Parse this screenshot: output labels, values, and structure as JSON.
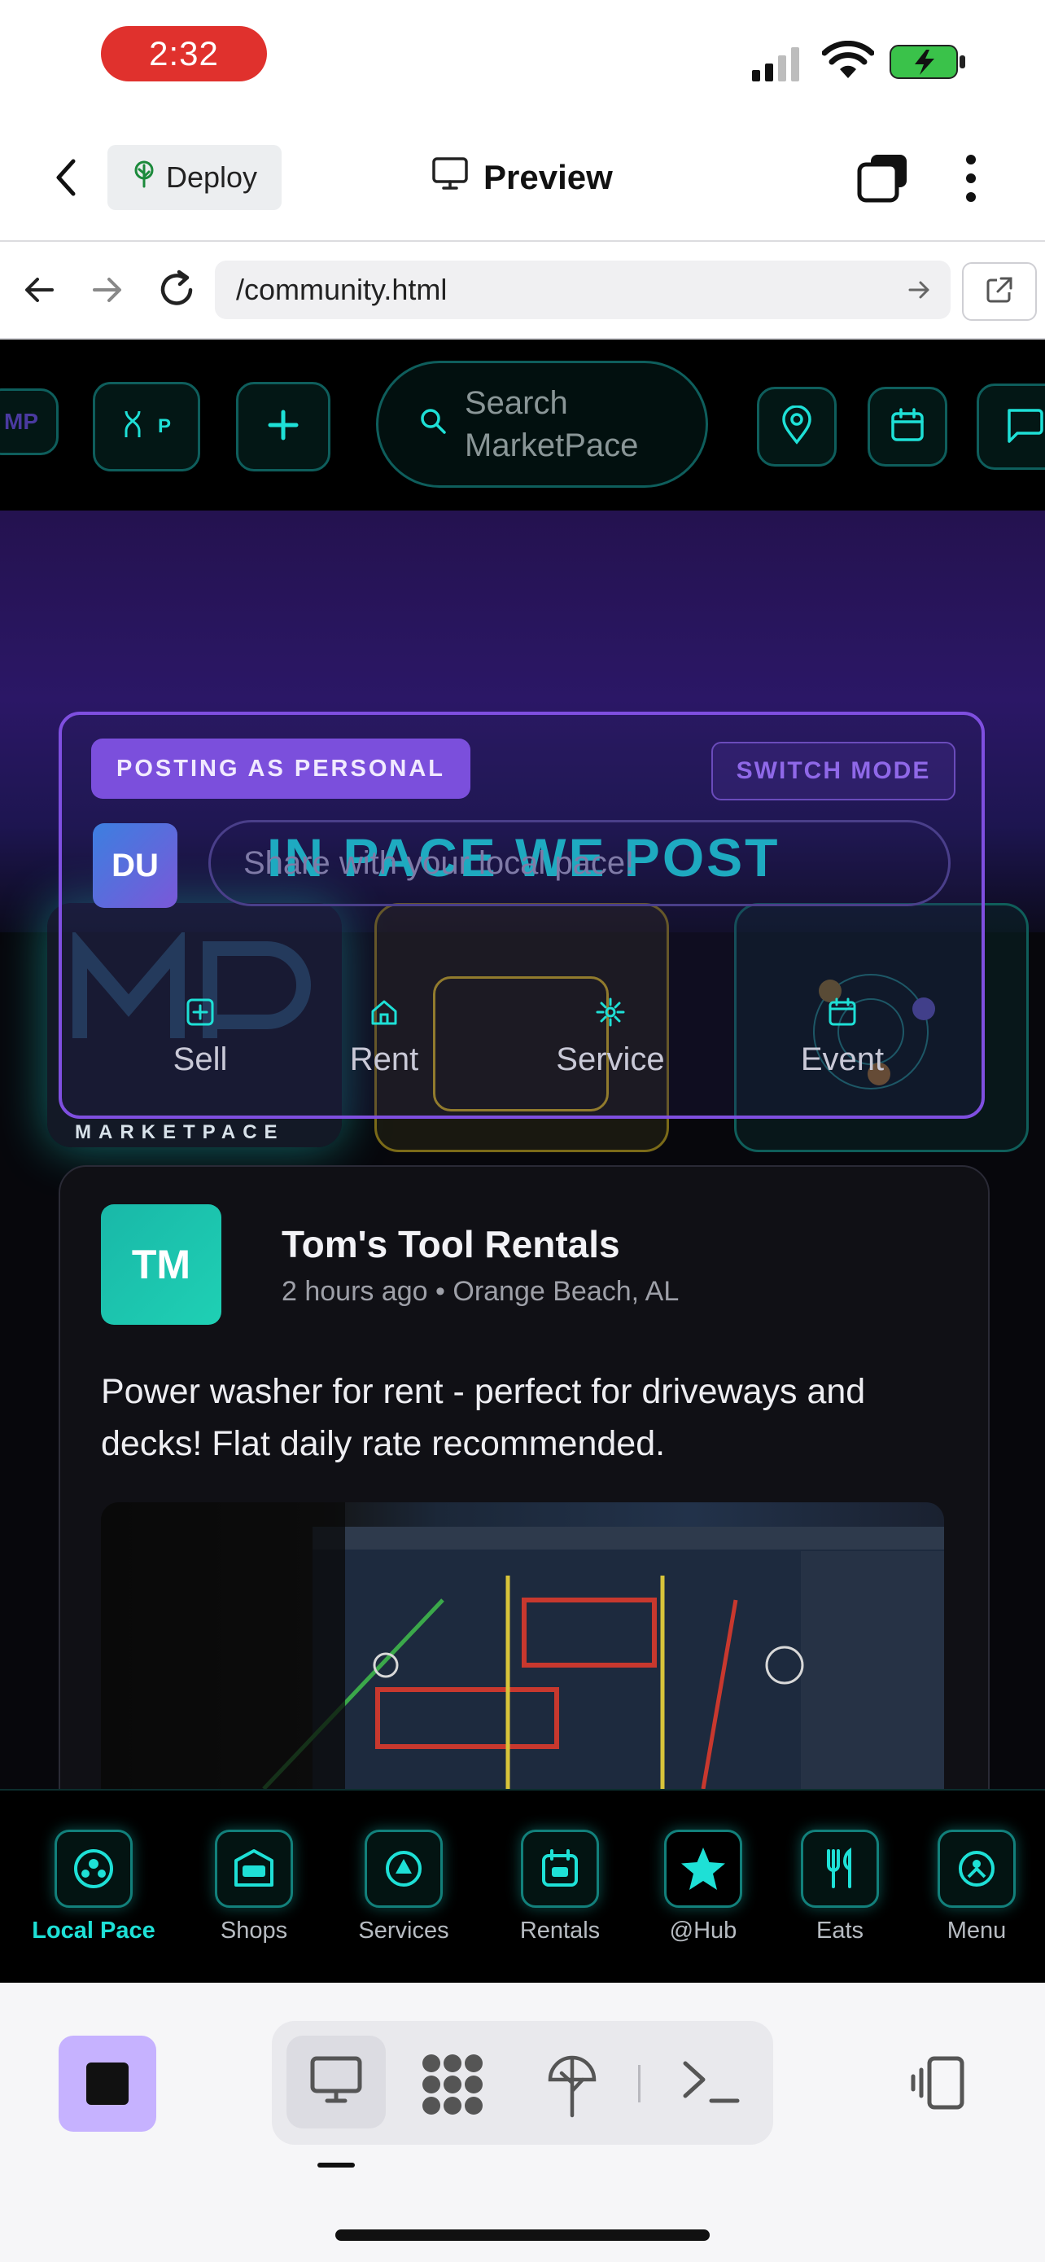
{
  "status": {
    "time": "2:32"
  },
  "header": {
    "deploy_label": "Deploy",
    "preview_label": "Preview"
  },
  "browser": {
    "url": "/community.html"
  },
  "topnav": {
    "logo_short": "MP",
    "p_label": "P",
    "search_placeholder_line1": "Search",
    "search_placeholder_line2": "MarketPace"
  },
  "brand": {
    "wordmark": "MARKETPACE"
  },
  "composer": {
    "mode_badge": "POSTING AS PERSONAL",
    "switch_label": "SWITCH MODE",
    "avatar_initials": "DU",
    "placeholder": "Share with your local pace!",
    "overlay_title": "IN PACE WE POST",
    "actions": [
      {
        "label": "Sell",
        "icon": "plus-square-icon"
      },
      {
        "label": "Rent",
        "icon": "house-icon"
      },
      {
        "label": "Service",
        "icon": "sparkle-icon"
      },
      {
        "label": "Event",
        "icon": "calendar-icon"
      }
    ]
  },
  "post": {
    "avatar_initials": "TM",
    "author": "Tom's Tool Rentals",
    "meta": "2 hours ago • Orange Beach, AL",
    "body": "Power washer for rent - perfect for driveways and decks! Flat daily rate recommended."
  },
  "bottomnav": [
    {
      "label": "Local Pace",
      "icon": "people-icon",
      "active": true
    },
    {
      "label": "Shops",
      "icon": "shop-icon",
      "active": false
    },
    {
      "label": "Services",
      "icon": "service-icon",
      "active": false
    },
    {
      "label": "Rentals",
      "icon": "rental-icon",
      "active": false
    },
    {
      "label": "@Hub",
      "icon": "star-icon",
      "active": false
    },
    {
      "label": "Eats",
      "icon": "utensils-icon",
      "active": false
    },
    {
      "label": "Menu",
      "icon": "menu-icon",
      "active": false
    }
  ],
  "colors": {
    "accent": "#1ee0d6",
    "purple": "#7b4fdc",
    "record_red": "#e0312d"
  }
}
